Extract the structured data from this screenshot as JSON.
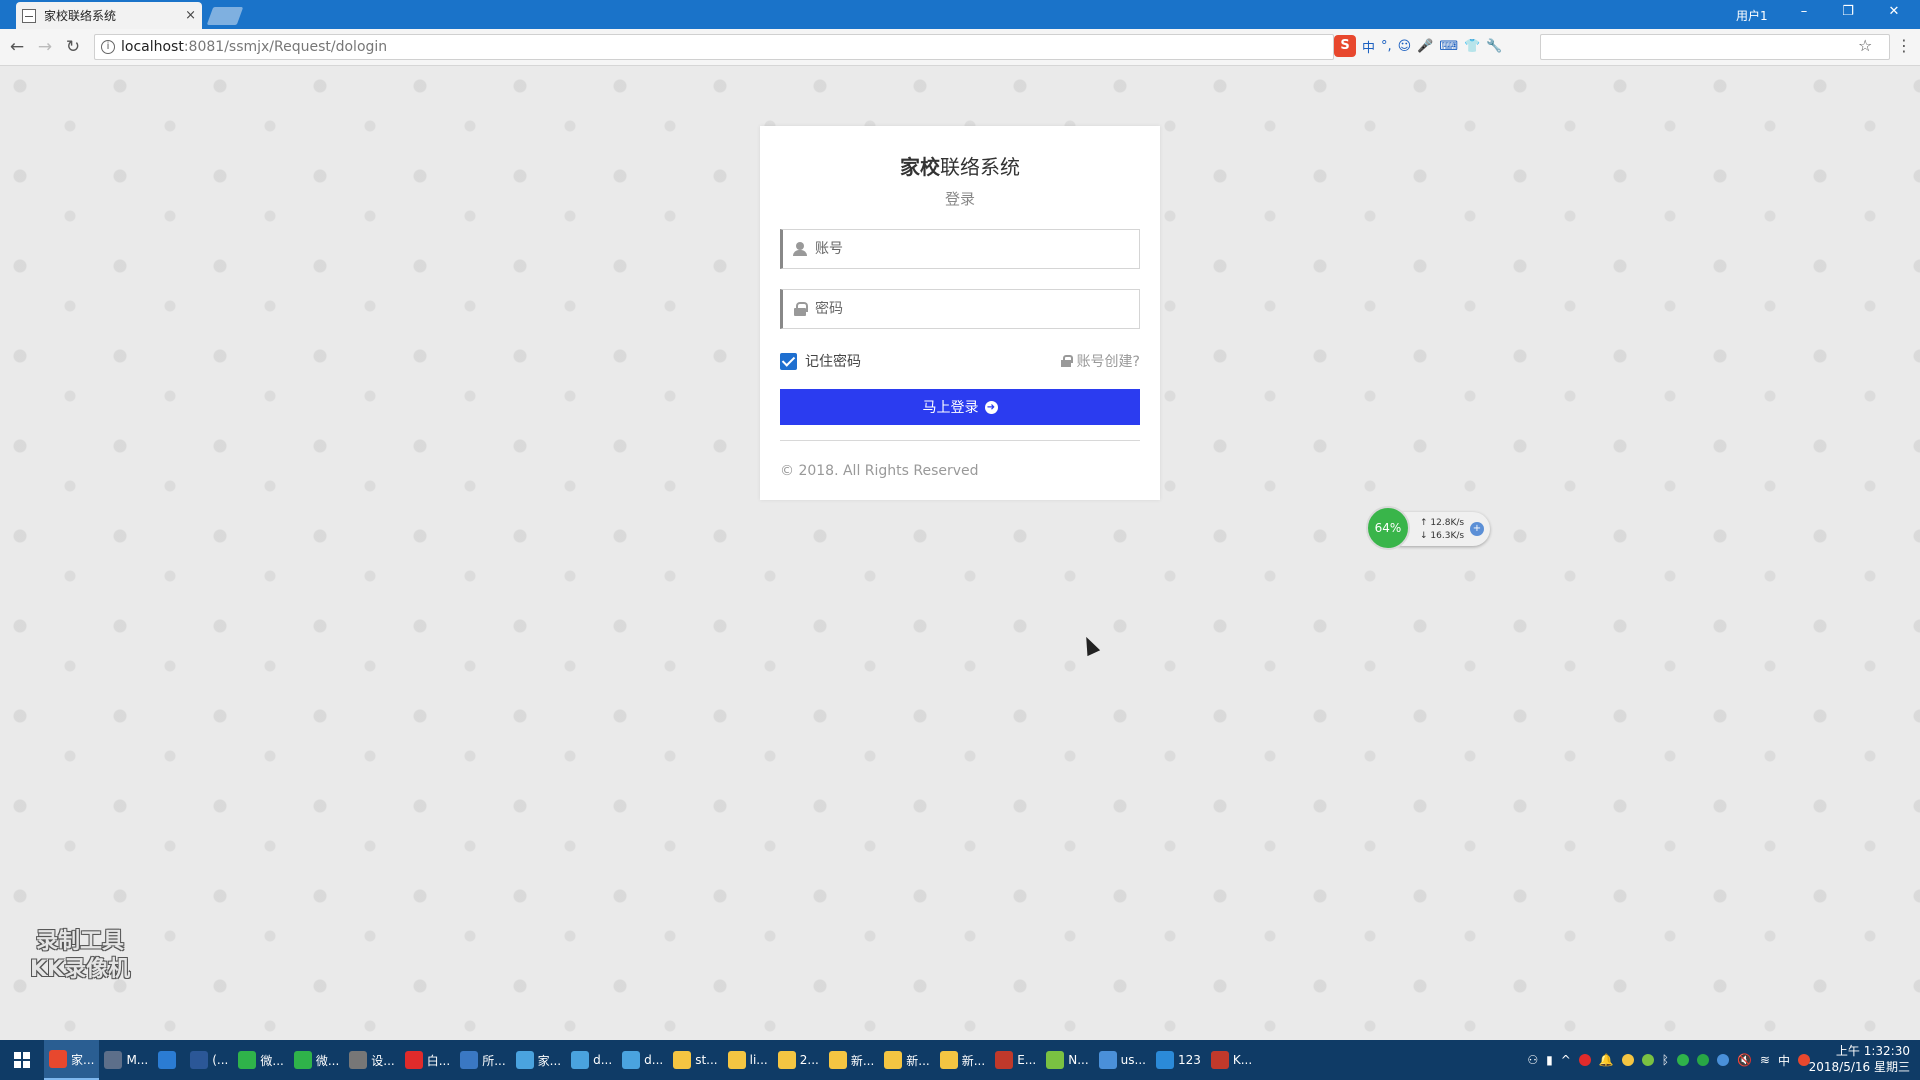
{
  "browser": {
    "tab_title": "家校联络系统",
    "tab_close": "×",
    "user_label": "用户1",
    "url_host": "localhost",
    "url_path": ":8081/ssmjx/Request/dologin",
    "ime_icons": [
      "中",
      "°,",
      "☺",
      "🎤",
      "⌨",
      "👕",
      "🔧"
    ]
  },
  "login": {
    "title_bold": "家校",
    "title_rest": "联络系统",
    "subtitle": "登录",
    "username_placeholder": "账号",
    "password_placeholder": "密码",
    "remember_label": "记住密码",
    "create_label": "账号创建?",
    "login_button": "马上登录",
    "copyright": "© 2018. All Rights Reserved"
  },
  "network_widget": {
    "percent": "64%",
    "upload": "12.8K/s",
    "download": "16.3K/s"
  },
  "watermark": {
    "line1": "录制工具",
    "line2": "KK录像机"
  },
  "taskbar": {
    "items": [
      {
        "label": "家...",
        "color": "#e8482e"
      },
      {
        "label": "M...",
        "color": "#5d6f8a"
      },
      {
        "label": "",
        "color": "#2b7cd3"
      },
      {
        "label": "(...",
        "color": "#2b5797"
      },
      {
        "label": "微...",
        "color": "#2fb34a"
      },
      {
        "label": "微...",
        "color": "#2fb34a"
      },
      {
        "label": "设...",
        "color": "#777777"
      },
      {
        "label": "白...",
        "color": "#e02b2b"
      },
      {
        "label": "所...",
        "color": "#3a78c3"
      },
      {
        "label": "家...",
        "color": "#4aa3df"
      },
      {
        "label": "d...",
        "color": "#4aa3df"
      },
      {
        "label": "d...",
        "color": "#4aa3df"
      },
      {
        "label": "st...",
        "color": "#f4c542"
      },
      {
        "label": "li...",
        "color": "#f4c542"
      },
      {
        "label": "2...",
        "color": "#f4c542"
      },
      {
        "label": "新...",
        "color": "#f4c542"
      },
      {
        "label": "新...",
        "color": "#f4c542"
      },
      {
        "label": "新...",
        "color": "#f4c542"
      },
      {
        "label": "E...",
        "color": "#c0392b"
      },
      {
        "label": "N...",
        "color": "#7ac142"
      },
      {
        "label": "us...",
        "color": "#4a90d9"
      },
      {
        "label": "123",
        "color": "#2b8ad8"
      },
      {
        "label": "K...",
        "color": "#c0392b"
      }
    ],
    "tray_lang": "中",
    "time": "上午 1:32:30",
    "date": "2018/5/16 星期三"
  }
}
